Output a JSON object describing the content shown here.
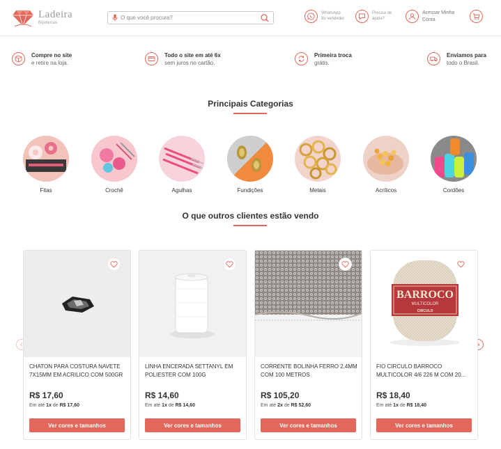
{
  "header": {
    "logo_text": "Ladeira",
    "logo_sub": "Bijuterias",
    "search_placeholder": "O que você procura?",
    "whatsapp_line1": "WhatsApp",
    "whatsapp_line2": "do vendedor",
    "help_line1": "Precisa de",
    "help_line2": "ajuda?",
    "account_line1": "Acessar Minha",
    "account_line2": "Conta"
  },
  "perks": [
    {
      "title": "Compre no site",
      "sub": "e retire na loja.",
      "icon": "box-icon"
    },
    {
      "title": "Todo o site em até 6x",
      "sub": "sem juros no cartão.",
      "icon": "credit-card-icon"
    },
    {
      "title": "Primeira troca",
      "sub": "grátis.",
      "icon": "exchange-icon"
    },
    {
      "title": "Enviamos para",
      "sub": "todo o Brasil.",
      "icon": "truck-icon"
    }
  ],
  "categories_title": "Principais Categorias",
  "categories": [
    {
      "label": "Fitas"
    },
    {
      "label": "Crochê"
    },
    {
      "label": "Agulhas"
    },
    {
      "label": "Fundições"
    },
    {
      "label": "Metais"
    },
    {
      "label": "Acrílicos"
    },
    {
      "label": "Cordões"
    }
  ],
  "products_title": "O que outros clientes estão vendo",
  "products": [
    {
      "name": "CHATON PARA COSTURA NAVETE 7X15MM EM ACRILICO COM 500GR",
      "price": "R$ 17,60",
      "inst_pre": "Em até ",
      "inst_n": "1x",
      "inst_mid": " de ",
      "inst_val": "R$ 17,60",
      "button": "Ver cores e tamanhos"
    },
    {
      "name": "LINHA ENCERADA SETTANYL EM POLIESTER COM 100G",
      "price": "R$ 14,60",
      "inst_pre": "Em até ",
      "inst_n": "1x",
      "inst_mid": " de ",
      "inst_val": "R$ 14,60",
      "button": "Ver cores e tamanhos"
    },
    {
      "name": "CORRENTE BOLINHA FERRO 2,4MM COM 100 METROS",
      "price": "R$ 105,20",
      "inst_pre": "Em até ",
      "inst_n": "2x",
      "inst_mid": " de ",
      "inst_val": "R$ 52,60",
      "button": "Ver cores e tamanhos"
    },
    {
      "name": "FIO CIRCULO BARROCO MULTICOLOR 4/6 226 M COM 20...",
      "price": "R$ 18,40",
      "inst_pre": "Em até ",
      "inst_n": "1x",
      "inst_mid": " de ",
      "inst_val": "R$ 18,40",
      "button": "Ver cores e tamanhos"
    }
  ],
  "barroco_label": {
    "brand": "BARROCO",
    "line": "MULTICOLOR",
    "maker": "CIRCULO"
  },
  "colors": {
    "accent": "#e3675a",
    "text": "#333333"
  }
}
